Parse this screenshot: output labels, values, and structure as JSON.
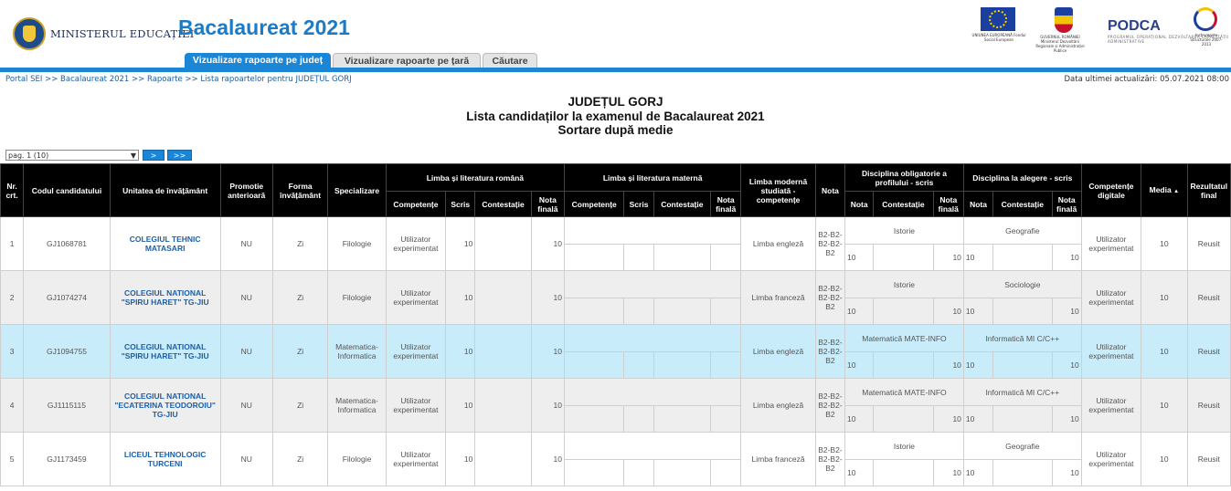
{
  "header": {
    "ministry_name": "MINISTERUL EDUCAȚIEI",
    "app_title": "Bacalaureat 2021",
    "logos": [
      {
        "icon": "eu-flag-icon",
        "caption": "UNIUNEA EUROPEANĂ Fondul Social European"
      },
      {
        "icon": "government-crest-icon",
        "caption": "GUVERNUL ROMÂNIEI Ministerul Dezvoltării Regionale și Administrației Publice"
      },
      {
        "icon": "podca-logo",
        "text": "PODCA",
        "caption": "PROGRAMUL OPERAȚIONAL DEZVOLTAREA CAPACITĂȚII ADMINISTRATIVE"
      },
      {
        "icon": "instrumente-structurale-logo",
        "caption": "Instrumente Structurale 2007-2013"
      }
    ]
  },
  "tabs": [
    {
      "label": "Vizualizare rapoarte pe județ",
      "active": true
    },
    {
      "label": "Vizualizare rapoarte pe țară",
      "active": false
    },
    {
      "label": "Căutare",
      "active": false
    }
  ],
  "breadcrumb": "Portal SEI >> Bacalaureat 2021 >> Rapoarte >> Lista rapoartelor pentru JUDEȚUL GORJ",
  "last_update": "Data ultimei actualizări: 05.07.2021 08:00",
  "titles": {
    "county": "JUDEȚUL GORJ",
    "list": "Lista candidaților la examenul de Bacalaureat 2021",
    "sort": "Sortare după medie"
  },
  "pager": {
    "selected": "pag. 1 (10)",
    "next": ">",
    "last": ">>"
  },
  "columns": {
    "nr": "Nr. crt.",
    "code": "Codul candidatului",
    "school": "Unitatea de învățământ",
    "promo": "Promotie anterioară",
    "form": "Forma învățământ",
    "spec": "Specializare",
    "romana": "Limba și literatura română",
    "materna": "Limba și literatura maternă",
    "modern": "Limba modernă studiată - competențe",
    "nota": "Nota",
    "obligatorie": "Disciplina obligatorie a profilului - scris",
    "alegere": "Disciplina la alegere - scris",
    "digitale": "Competențe digitale",
    "media": "Media",
    "rezultat": "Rezultatul final",
    "sub": {
      "competente": "Competențe",
      "scris": "Scris",
      "contestatie": "Contestație",
      "nota_finala": "Nota finală",
      "nota": "Nota"
    }
  },
  "rows": [
    {
      "nr": "1",
      "code": "GJ1068781",
      "school": "COLEGIUL TEHNIC MATASARI",
      "promo": "NU",
      "form": "Zi",
      "spec": "Filologie",
      "ro_comp": "Utilizator experimentat",
      "ro_scris": "10",
      "ro_cont": "",
      "ro_final": "10",
      "modern": "Limba engleză",
      "nota": "B2-B2-B2-B2-B2",
      "obl_name": "Istorie",
      "obl_nota": "10",
      "obl_cont": "",
      "obl_final": "10",
      "ale_name": "Geografie",
      "ale_nota": "10",
      "ale_cont": "",
      "ale_final": "10",
      "digitale": "Utilizator experimentat",
      "media": "10",
      "rezultat": "Reusit"
    },
    {
      "nr": "2",
      "code": "GJ1074274",
      "school": "COLEGIUL NATIONAL \"SPIRU HARET\" TG-JIU",
      "promo": "NU",
      "form": "Zi",
      "spec": "Filologie",
      "ro_comp": "Utilizator experimentat",
      "ro_scris": "10",
      "ro_cont": "",
      "ro_final": "10",
      "modern": "Limba franceză",
      "nota": "B2-B2-B2-B2-B2",
      "obl_name": "Istorie",
      "obl_nota": "10",
      "obl_cont": "",
      "obl_final": "10",
      "ale_name": "Sociologie",
      "ale_nota": "10",
      "ale_cont": "",
      "ale_final": "10",
      "digitale": "Utilizator experimentat",
      "media": "10",
      "rezultat": "Reusit"
    },
    {
      "nr": "3",
      "code": "GJ1094755",
      "school": "COLEGIUL NATIONAL \"SPIRU HARET\" TG-JIU",
      "promo": "NU",
      "form": "Zi",
      "spec": "Matematica-Informatica",
      "ro_comp": "Utilizator experimentat",
      "ro_scris": "10",
      "ro_cont": "",
      "ro_final": "10",
      "modern": "Limba engleză",
      "nota": "B2-B2-B2-B2-B2",
      "obl_name": "Matematică MATE-INFO",
      "obl_nota": "10",
      "obl_cont": "",
      "obl_final": "10",
      "ale_name": "Informatică MI C/C++",
      "ale_nota": "10",
      "ale_cont": "",
      "ale_final": "10",
      "digitale": "Utilizator experimentat",
      "media": "10",
      "rezultat": "Reusit"
    },
    {
      "nr": "4",
      "code": "GJ1115115",
      "school": "COLEGIUL NATIONAL \"ECATERINA TEODOROIU\" TG-JIU",
      "promo": "NU",
      "form": "Zi",
      "spec": "Matematica-Informatica",
      "ro_comp": "Utilizator experimentat",
      "ro_scris": "10",
      "ro_cont": "",
      "ro_final": "10",
      "modern": "Limba engleză",
      "nota": "B2-B2-B2-B2-B2",
      "obl_name": "Matematică MATE-INFO",
      "obl_nota": "10",
      "obl_cont": "",
      "obl_final": "10",
      "ale_name": "Informatică MI C/C++",
      "ale_nota": "10",
      "ale_cont": "",
      "ale_final": "10",
      "digitale": "Utilizator experimentat",
      "media": "10",
      "rezultat": "Reusit"
    },
    {
      "nr": "5",
      "code": "GJ1173459",
      "school": "LICEUL TEHNOLOGIC TURCENI",
      "promo": "NU",
      "form": "Zi",
      "spec": "Filologie",
      "ro_comp": "Utilizator experimentat",
      "ro_scris": "10",
      "ro_cont": "",
      "ro_final": "10",
      "modern": "Limba franceză",
      "nota": "B2-B2-B2-B2-B2",
      "obl_name": "Istorie",
      "obl_nota": "10",
      "obl_cont": "",
      "obl_final": "10",
      "ale_name": "Geografie",
      "ale_nota": "10",
      "ale_cont": "",
      "ale_final": "10",
      "digitale": "Utilizator experimentat",
      "media": "10",
      "rezultat": "Reusit"
    }
  ]
}
